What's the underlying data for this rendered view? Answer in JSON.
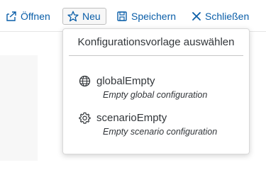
{
  "toolbar": {
    "open_label": "Öffnen",
    "new_label": "Neu",
    "save_label": "Speichern",
    "close_label": "Schließen"
  },
  "popover": {
    "title": "Konfigurationsvorlage auswählen",
    "options": [
      {
        "name": "globalEmpty",
        "description": "Empty global configuration",
        "icon": "globe-icon"
      },
      {
        "name": "scenarioEmpty",
        "description": "Empty scenario configuration",
        "icon": "gear-icon"
      }
    ]
  },
  "colors": {
    "accent": "#0a5ea8",
    "text": "#32363a",
    "border": "#d9d9d9"
  }
}
